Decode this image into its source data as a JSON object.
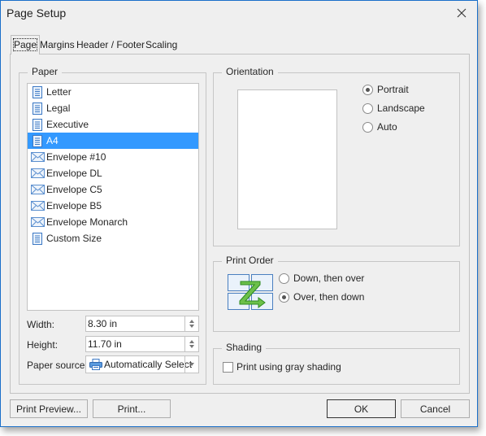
{
  "window": {
    "title": "Page Setup",
    "close_icon": "close-icon"
  },
  "tabs": [
    {
      "label": "Page",
      "accel": "P",
      "active": true
    },
    {
      "label": "Margins",
      "accel": "M",
      "active": false
    },
    {
      "label": "Header / Footer",
      "accel": "H",
      "active": false
    },
    {
      "label": "Scaling",
      "accel": "S",
      "active": false
    }
  ],
  "paper": {
    "group_label": "Paper",
    "items": [
      {
        "label": "Letter",
        "icon": "page-icon",
        "selected": false
      },
      {
        "label": "Legal",
        "icon": "page-icon",
        "selected": false
      },
      {
        "label": "Executive",
        "icon": "page-icon",
        "selected": false
      },
      {
        "label": "A4",
        "icon": "page-icon",
        "selected": true
      },
      {
        "label": "Envelope #10",
        "icon": "envelope-icon",
        "selected": false
      },
      {
        "label": "Envelope DL",
        "icon": "envelope-icon",
        "selected": false
      },
      {
        "label": "Envelope C5",
        "icon": "envelope-icon",
        "selected": false
      },
      {
        "label": "Envelope B5",
        "icon": "envelope-icon",
        "selected": false
      },
      {
        "label": "Envelope Monarch",
        "icon": "envelope-icon",
        "selected": false
      },
      {
        "label": "Custom Size",
        "icon": "page-icon",
        "selected": false
      }
    ],
    "width_label": "Width:",
    "width_value": "8.30 in",
    "height_label": "Height:",
    "height_value": "11.70 in",
    "source_label": "Paper source:",
    "source_value": "Automatically Select"
  },
  "orientation": {
    "group_label": "Orientation",
    "options": [
      {
        "label": "Portrait",
        "checked": true
      },
      {
        "label": "Landscape",
        "checked": false
      },
      {
        "label": "Auto",
        "checked": false
      }
    ]
  },
  "print_order": {
    "group_label": "Print Order",
    "options": [
      {
        "label": "Down, then over",
        "checked": false
      },
      {
        "label": "Over, then down",
        "checked": true
      }
    ]
  },
  "shading": {
    "group_label": "Shading",
    "checkbox_label": "Print using gray shading",
    "checked": false
  },
  "buttons": {
    "print_preview": "Print Preview...",
    "print": "Print...",
    "ok": "OK",
    "cancel": "Cancel"
  },
  "colors": {
    "selection": "#3399ff",
    "window_border": "#1a6fc9",
    "arrow_green": "#3a9a2a"
  }
}
